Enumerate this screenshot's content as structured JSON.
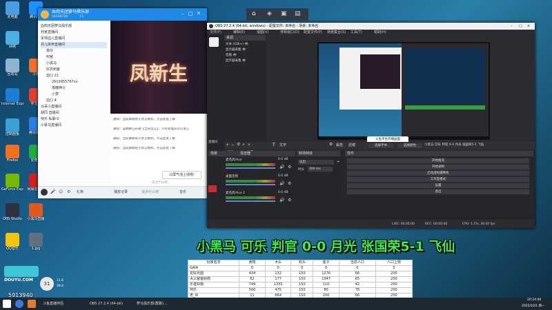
{
  "desktop": {
    "icons": [
      {
        "label": "此电脑",
        "color": "#4a9de0"
      },
      {
        "label": "腾讯QQ",
        "color": "#1e90ff"
      },
      {
        "label": "网络",
        "color": "#4ab0e0"
      },
      {
        "label": "回收站",
        "color": "#8fb4d0"
      },
      {
        "label": "Internet Explorer",
        "color": "#1c7fd6"
      },
      {
        "label": "控制面板",
        "color": "#3aa0d8"
      },
      {
        "label": "Firefox",
        "color": "#f07020"
      },
      {
        "label": "GeForce Experience",
        "color": "#76b900"
      },
      {
        "label": "OBS Studio",
        "color": "#303040"
      },
      {
        "label": "QQ音乐",
        "color": "#f2c40c"
      },
      {
        "label": "斗鱼",
        "color": "#f07030"
      },
      {
        "label": "学习通",
        "color": "#e04030"
      },
      {
        "label": "腾讯会议",
        "color": "#2a80e0"
      },
      {
        "label": "爱奇艺",
        "color": "#22aa44"
      },
      {
        "label": "网易云音乐",
        "color": "#d02020"
      },
      {
        "label": "小黑马直播",
        "color": "#e05a20"
      },
      {
        "label": "1.jpg",
        "color": "#607080"
      }
    ],
    "douyu_logo": "DOUYU.COM",
    "douyu_id": "5913940",
    "cpu_badge": "31",
    "cpu_up": "11.6",
    "cpu_down": "39.4"
  },
  "chat": {
    "title": "血肉天团萝马俱乐部",
    "group_id": "56108728",
    "member_count": "13",
    "groups": [
      "血肉天团萝马俱乐部",
      "判官直播间",
      "军师血儿直播间",
      "月儿拼命直播间",
      "菲仔",
      "判官",
      "小黑马",
      "红衣刺客",
      "血口 21",
      "2619955767xx",
      "落魄神父",
      "小梦",
      "血口 4",
      "马哥小直播间",
      "胡同 直播间",
      "快乐 私聊 0",
      "小豪马直播间"
    ],
    "banner_text": "凤新生",
    "messages": [
      "通知：当前群聊处于禁言模式，点击此处了解",
      "通知：该群聊已开通【全员禁言】，只有管理员可以发言",
      "通知：当前群聊处于禁言模式，点击此处了解",
      "通知：当前群聊处于禁言模式，点击此处了解"
    ],
    "popup": "公屏气泡上线啦!",
    "input_placeholder": "说点什么吧...",
    "bottom": {
      "gift": "礼物",
      "record": "播放记录",
      "hint": "说点什么吧",
      "music": "音乐"
    }
  },
  "obs": {
    "title": "OBS 27.2.4 (64-bit, windows) - 配置文件: 未命名 - 场景: 未命名",
    "menu": [
      "文件(F)",
      "编辑(E)",
      "视图(V)",
      "停靠窗口(D)",
      "配置文件(P)",
      "场景集合(S)",
      "工具(T)",
      "帮助(H)"
    ],
    "sources_header": "来源",
    "sources": [
      "文本 (GDI+)",
      "显示器采集",
      "音频",
      "显示器采集"
    ],
    "scene_header": "场景",
    "scene_tabs": [
      "场景",
      "来源"
    ],
    "properties_text": "文字",
    "filters_text": "滤镜",
    "props_buttons": [
      "选择字体",
      "选择颜色"
    ],
    "ticker": "小黑马 可乐 判官 0-0 月光 张国荣5-1 飞仙",
    "mixer_header": "混音器",
    "mixer_tracks": [
      {
        "name": "麦克风/Aux",
        "db": "0.0 dB"
      },
      {
        "name": "桌面音频",
        "db": "0.0 dB"
      },
      {
        "name": "麦克风/Aux 2",
        "db": "0.0 dB"
      }
    ],
    "transition_header": "转场特效",
    "transition_value": "淡出",
    "duration_label": "时长",
    "duration_value": "300 ms",
    "controls_header": "控件",
    "controls": [
      "开始推流",
      "开始录制",
      "启动虚拟摄像机",
      "工作室模式",
      "设置",
      "退出"
    ],
    "status_live": "LIVE: 00:00:00",
    "status_rec": "REC: 00:00:00",
    "status_cpu": "CPU: 1.1%, 30.00 fps",
    "preview_tooltip": "斗鱼平台开播画面",
    "left_label": "直播间"
  },
  "caption": "小黑马 可乐 判官 0-0 月光 张国荣5-1 飞仙",
  "table": {
    "headers": [
      "玩家名字",
      "食物",
      "木头",
      "石头",
      "金子",
      "当前人口",
      "人口上限"
    ],
    "rows": [
      [
        "GAIA",
        "0",
        "0",
        "0",
        "0",
        "0",
        "0"
      ],
      [
        "花好月圆",
        "434",
        "132",
        "150",
        "1276",
        "66",
        "200"
      ],
      [
        "大三爸爸射箭",
        "62",
        "177",
        "150",
        "1347",
        "65",
        "200"
      ],
      [
        "乐善好施",
        "749",
        "1333",
        "150",
        "110",
        "42",
        "200"
      ],
      [
        "阿乐",
        "500",
        "475",
        "150",
        "80",
        "78",
        "200"
      ],
      [
        "老_兵",
        "11",
        "664",
        "150",
        "200",
        "66",
        "200"
      ],
      [
        "战争",
        "1050",
        "660",
        "150",
        "154",
        "113",
        "200"
      ]
    ]
  },
  "taskbar": {
    "items": [
      "斗鱼直播伴侣",
      "OBS 27.2.4 (64-bit)",
      "萝马俱乐部(群聊)..."
    ],
    "time": "20:24:40",
    "date": "2022/10/1 周一"
  }
}
